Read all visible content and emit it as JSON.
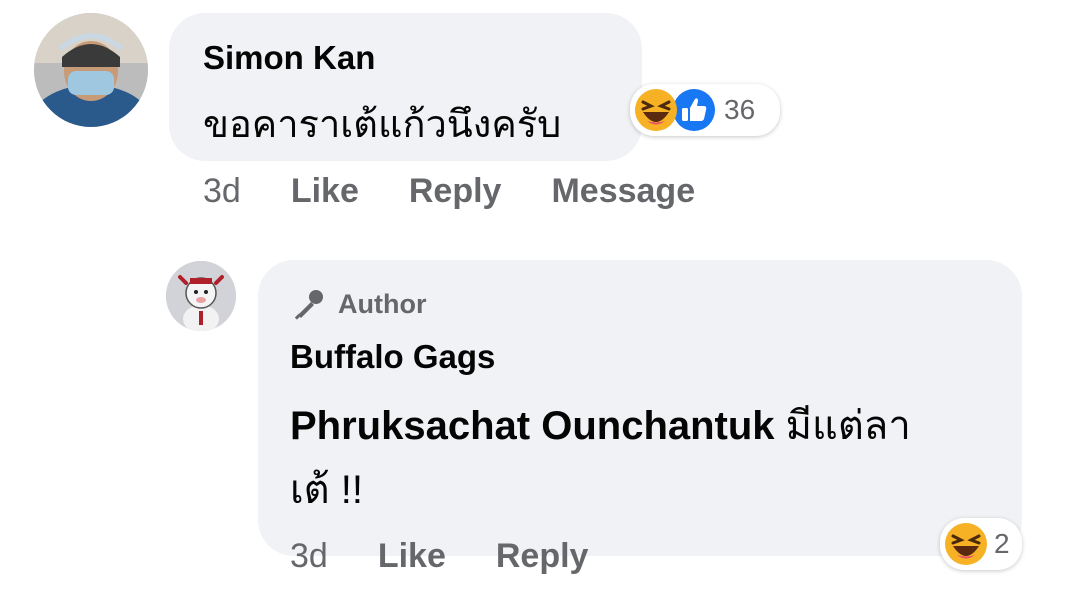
{
  "comments": [
    {
      "author": "Simon Kan",
      "text": "ขอคาราเต้แก้วนึงครับ",
      "time": "3d",
      "actions": [
        "Like",
        "Reply",
        "Message"
      ],
      "reactions": {
        "icons": [
          "laugh-emoji",
          "like-thumb"
        ],
        "count": "36"
      }
    },
    {
      "badge": "Author",
      "author": "Buffalo Gags",
      "mention": "Phruksachat Ounchantuk",
      "text_line1": " มีแต่ลา",
      "text_line2": "เต้ !!",
      "time": "3d",
      "actions": [
        "Like",
        "Reply"
      ],
      "reactions": {
        "icons": [
          "laugh-emoji"
        ],
        "count": "2"
      }
    }
  ],
  "colors": {
    "bubble": "#f0f2f5",
    "secondary_text": "#65676b",
    "like_blue": "#1877f2",
    "emoji_yellow": "#f7b125"
  }
}
